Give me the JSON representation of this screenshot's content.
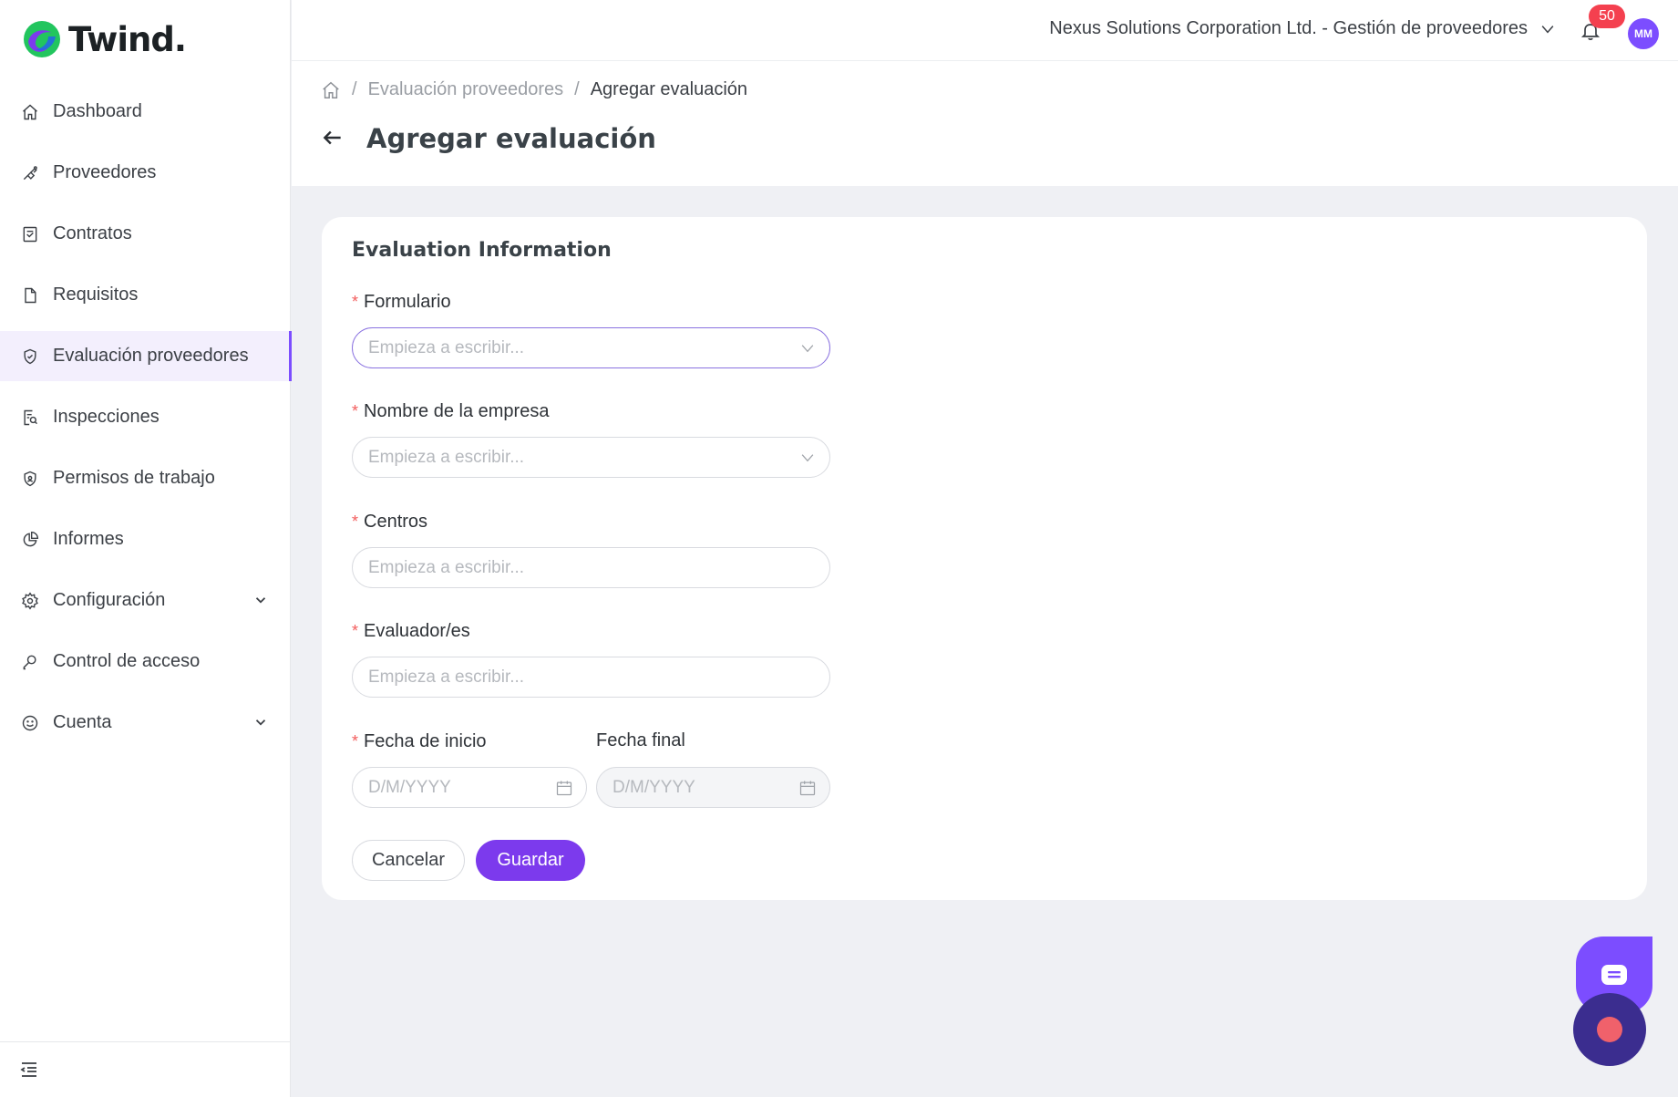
{
  "brand": {
    "name": "Twind."
  },
  "sidebar": {
    "items": [
      {
        "label": "Dashboard",
        "icon": "home-icon"
      },
      {
        "label": "Proveedores",
        "icon": "handshake-icon"
      },
      {
        "label": "Contratos",
        "icon": "contract-icon"
      },
      {
        "label": "Requisitos",
        "icon": "document-icon"
      },
      {
        "label": "Evaluación proveedores",
        "icon": "shield-check-icon",
        "active": true
      },
      {
        "label": "Inspecciones",
        "icon": "inspection-icon"
      },
      {
        "label": "Permisos de trabajo",
        "icon": "permit-shield-icon"
      },
      {
        "label": "Informes",
        "icon": "pie-chart-icon"
      },
      {
        "label": "Configuración",
        "icon": "gear-icon",
        "expandable": true
      },
      {
        "label": "Control de acceso",
        "icon": "key-icon"
      },
      {
        "label": "Cuenta",
        "icon": "smiley-icon",
        "expandable": true
      }
    ]
  },
  "header": {
    "org": "Nexus Solutions Corporation Ltd. - Gestión de proveedores",
    "notifications": "50",
    "avatar": "MM"
  },
  "breadcrumb": {
    "parent": "Evaluación proveedores",
    "current": "Agregar evaluación"
  },
  "page": {
    "title": "Agregar evaluación"
  },
  "form": {
    "section_title": "Evaluation Information",
    "formulario": {
      "label": "Formulario",
      "placeholder": "Empieza a escribir..."
    },
    "empresa": {
      "label": "Nombre de la empresa",
      "placeholder": "Empieza a escribir..."
    },
    "centros": {
      "label": "Centros",
      "placeholder": "Empieza a escribir..."
    },
    "evaluadores": {
      "label": "Evaluador/es",
      "placeholder": "Empieza a escribir..."
    },
    "fecha_inicio": {
      "label": "Fecha de inicio",
      "placeholder": "D/M/YYYY"
    },
    "fecha_final": {
      "label": "Fecha final",
      "placeholder": "D/M/YYYY"
    },
    "required_mark": "*",
    "cancel_label": "Cancelar",
    "save_label": "Guardar"
  },
  "colors": {
    "accent": "#7c3aed",
    "badge": "#f4404f",
    "recorder": "#3b2d8f"
  }
}
